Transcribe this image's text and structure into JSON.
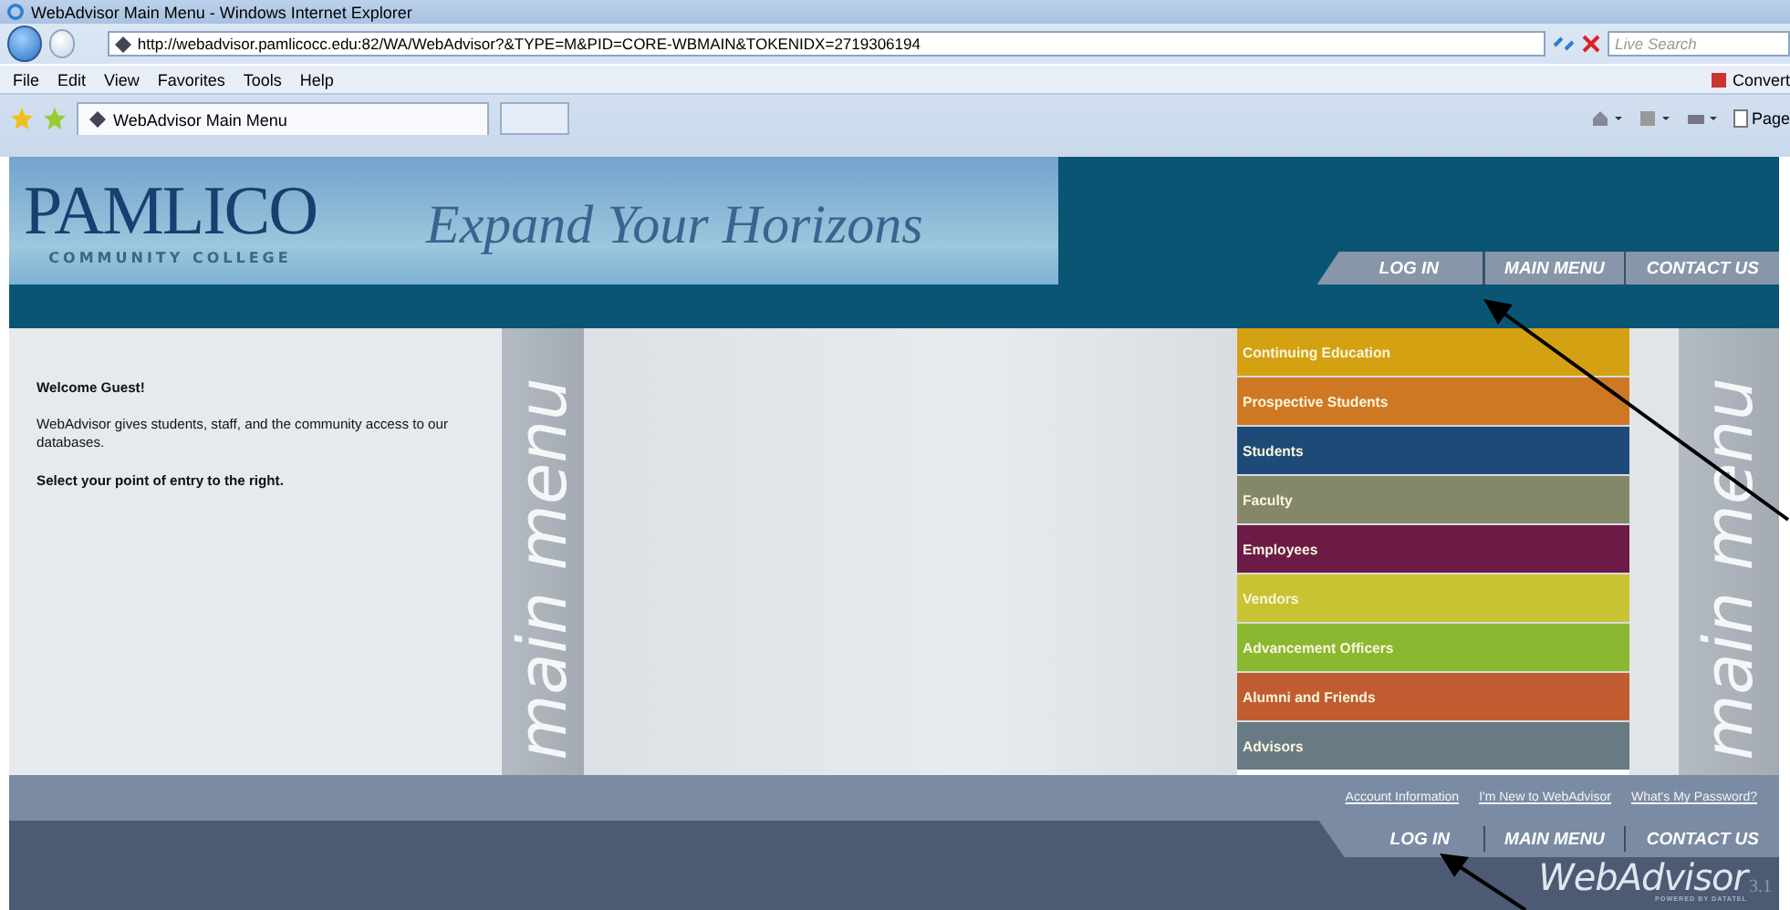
{
  "browser": {
    "title": "WebAdvisor Main Menu - Windows Internet Explorer",
    "url": "http://webadvisor.pamlicocc.edu:82/WA/WebAdvisor?&TYPE=M&PID=CORE-WBMAIN&TOKENIDX=2719306194",
    "search": {
      "placeholder": "Live Search"
    },
    "menus": [
      "File",
      "Edit",
      "View",
      "Favorites",
      "Tools",
      "Help"
    ],
    "convert": "Convert",
    "tab": {
      "label": "WebAdvisor Main Menu",
      "selected": true
    },
    "page_menu": "Page"
  },
  "header": {
    "logo": "PAMLICO",
    "logo_subtitle": "COMMUNITY COLLEGE",
    "tagline": "Expand Your Horizons",
    "nav": [
      "LOG IN",
      "MAIN MENU",
      "CONTACT US"
    ]
  },
  "welcome": {
    "heading": "Welcome Guest!",
    "body": "WebAdvisor gives students, staff, and the community access to our databases.",
    "instruction": "Select your point of entry to the right."
  },
  "side_marks": [
    "main menu",
    "main menu"
  ],
  "menu": [
    {
      "label": "Continuing Education",
      "color": "#d4a113"
    },
    {
      "label": "Prospective Students",
      "color": "#cf7824"
    },
    {
      "label": "Students",
      "color": "#1e4a78"
    },
    {
      "label": "Faculty",
      "color": "#858868"
    },
    {
      "label": "Employees",
      "color": "#6b1b46"
    },
    {
      "label": "Vendors",
      "color": "#c9c232"
    },
    {
      "label": "Advancement Officers",
      "color": "#8ab830"
    },
    {
      "label": "Alumni and Friends",
      "color": "#c15c31"
    },
    {
      "label": "Advisors",
      "color": "#687a84"
    }
  ],
  "footer": {
    "links": [
      "Account Information",
      "I'm New to WebAdvisor",
      "What's My Password?"
    ],
    "nav": [
      "LOG IN",
      "MAIN MENU",
      "CONTACT US"
    ],
    "logo": "WebAdvisor",
    "version": "3.1",
    "powered": "POWERED BY DATATEL"
  }
}
